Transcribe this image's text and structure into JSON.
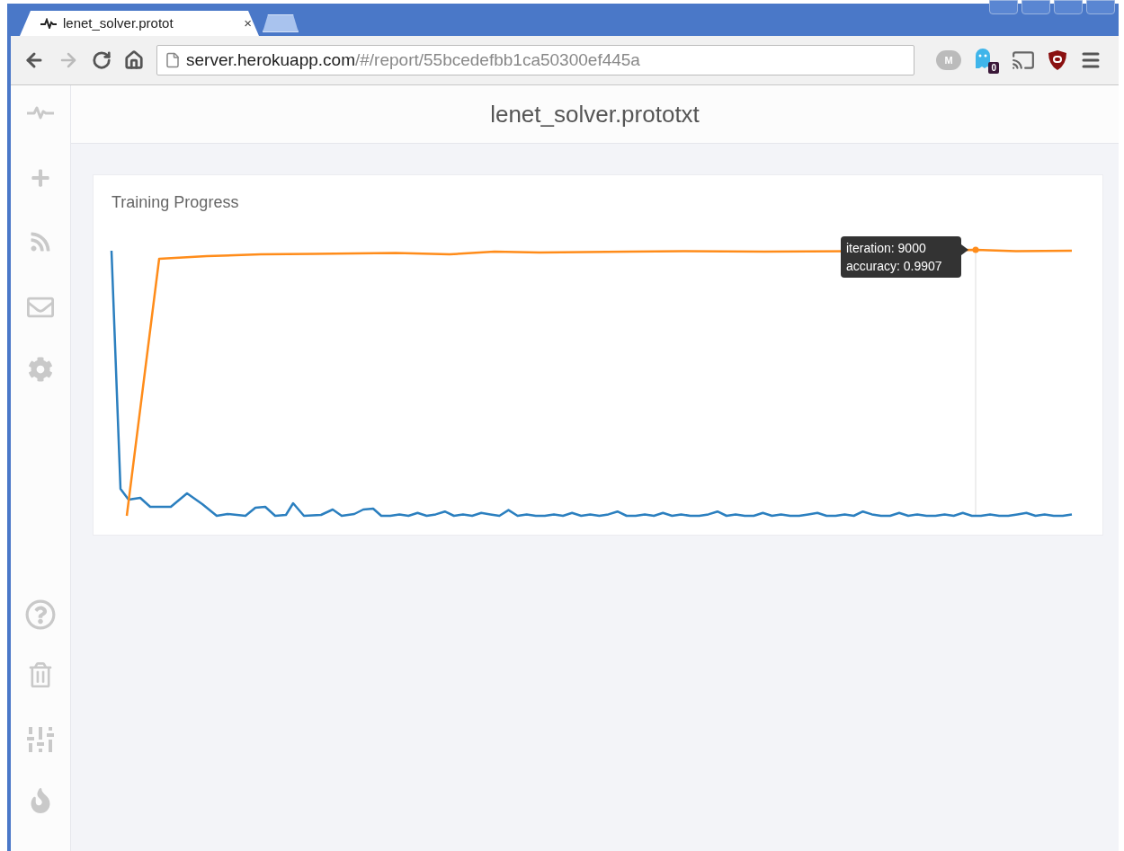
{
  "browser": {
    "tab": {
      "title": "lenet_solver.protot",
      "close": "×"
    },
    "address": {
      "host": "server.herokuapp.com",
      "path": "/#/report/55bcedefbb1ca50300ef445a"
    },
    "extensions": {
      "cloud_letter": "M",
      "ghost_badge": "0"
    }
  },
  "page": {
    "title": "lenet_solver.prototxt",
    "card": {
      "title": "Training Progress",
      "tooltip": {
        "lines": [
          "iteration: 9000",
          "accuracy: 0.9907"
        ]
      }
    }
  }
}
